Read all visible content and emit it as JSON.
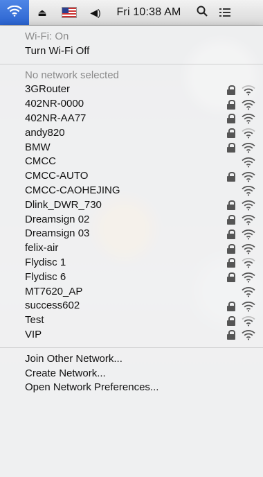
{
  "menubar": {
    "clock": "Fri 10:38 AM",
    "items": [
      "wifi-icon",
      "eject-icon",
      "flag-icon",
      "volume-icon",
      "clock",
      "search-icon",
      "list-icon"
    ]
  },
  "wifi_menu": {
    "status": "Wi-Fi: On",
    "toggle_label": "Turn Wi-Fi Off",
    "no_network": "No network selected",
    "networks": [
      {
        "name": "3GRouter",
        "locked": true,
        "signal": 2
      },
      {
        "name": "402NR-0000",
        "locked": true,
        "signal": 3
      },
      {
        "name": "402NR-AA77",
        "locked": true,
        "signal": 3
      },
      {
        "name": "andy820",
        "locked": true,
        "signal": 2
      },
      {
        "name": "BMW",
        "locked": true,
        "signal": 3
      },
      {
        "name": "CMCC",
        "locked": false,
        "signal": 3
      },
      {
        "name": "CMCC-AUTO",
        "locked": true,
        "signal": 3
      },
      {
        "name": "CMCC-CAOHEJING",
        "locked": false,
        "signal": 3
      },
      {
        "name": "Dlink_DWR_730",
        "locked": true,
        "signal": 3
      },
      {
        "name": "Dreamsign 02",
        "locked": true,
        "signal": 3
      },
      {
        "name": "Dreamsign 03",
        "locked": true,
        "signal": 3
      },
      {
        "name": "felix-air",
        "locked": true,
        "signal": 3
      },
      {
        "name": "Flydisc 1",
        "locked": true,
        "signal": 2
      },
      {
        "name": "Flydisc 6",
        "locked": true,
        "signal": 3
      },
      {
        "name": "MT7620_AP",
        "locked": false,
        "signal": 3
      },
      {
        "name": "success602",
        "locked": true,
        "signal": 3
      },
      {
        "name": "Test",
        "locked": true,
        "signal": 2
      },
      {
        "name": "VIP",
        "locked": true,
        "signal": 3
      }
    ],
    "actions": [
      "Join Other Network...",
      "Create Network...",
      "Open Network Preferences..."
    ]
  },
  "colors": {
    "menubar_selected": "#2a63cf",
    "menu_bg": "#f6f6f6",
    "dim_text": "#8a8a8a"
  }
}
